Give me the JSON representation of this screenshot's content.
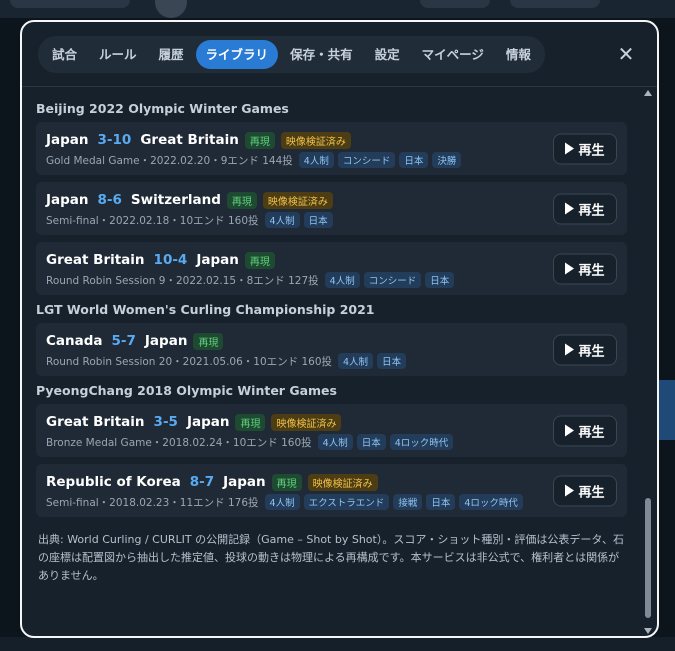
{
  "tabs": [
    {
      "label": "試合",
      "active": false
    },
    {
      "label": "ルール",
      "active": false
    },
    {
      "label": "履歴",
      "active": false
    },
    {
      "label": "ライブラリ",
      "active": true
    },
    {
      "label": "保存・共有",
      "active": false
    },
    {
      "label": "設定",
      "active": false
    },
    {
      "label": "マイページ",
      "active": false
    },
    {
      "label": "情報",
      "active": false
    }
  ],
  "close_symbol": "✕",
  "play_label": "再生",
  "badges": {
    "replay": "再現",
    "verified": "映像検証済み"
  },
  "sections": [
    {
      "title": "Beijing 2022 Olympic Winter Games",
      "games": [
        {
          "team1": "Japan",
          "score": "3-10",
          "team2": "Great Britain",
          "verified": true,
          "meta": "Gold Medal Game・2022.02.20・9エンド 144投",
          "tags": [
            "4人制",
            "コンシード",
            "日本",
            "決勝"
          ]
        },
        {
          "team1": "Japan",
          "score": "8-6",
          "team2": "Switzerland",
          "verified": true,
          "meta": "Semi-final・2022.02.18・10エンド 160投",
          "tags": [
            "4人制",
            "日本"
          ]
        },
        {
          "team1": "Great Britain",
          "score": "10-4",
          "team2": "Japan",
          "verified": false,
          "meta": "Round Robin Session 9・2022.02.15・8エンド 127投",
          "tags": [
            "4人制",
            "コンシード",
            "日本"
          ]
        }
      ]
    },
    {
      "title": "LGT World Women's Curling Championship 2021",
      "games": [
        {
          "team1": "Canada",
          "score": "5-7",
          "team2": "Japan",
          "verified": false,
          "meta": "Round Robin Session 20・2021.05.06・10エンド 160投",
          "tags": [
            "4人制",
            "日本"
          ]
        }
      ]
    },
    {
      "title": "PyeongChang 2018 Olympic Winter Games",
      "games": [
        {
          "team1": "Great Britain",
          "score": "3-5",
          "team2": "Japan",
          "verified": true,
          "meta": "Bronze Medal Game・2018.02.24・10エンド 160投",
          "tags": [
            "4人制",
            "日本",
            "4ロック時代"
          ]
        },
        {
          "team1": "Republic of Korea",
          "score": "8-7",
          "team2": "Japan",
          "verified": true,
          "meta": "Semi-final・2018.02.23・11エンド 176投",
          "tags": [
            "4人制",
            "エクストラエンド",
            "接戦",
            "日本",
            "4ロック時代"
          ]
        }
      ]
    }
  ],
  "footnote": "出典: World Curling / CURLIT の公開記録（Game – Shot by Shot）。スコア・ショット種別・評価は公表データ、石の座標は配置図から抽出した推定値、投球の動きは物理による再構成です。本サービスは非公式で、権利者とは関係がありません。",
  "colors": {
    "accent": "#2a7bd3",
    "score": "#5aaaf2",
    "replay_badge": "#5fd37e",
    "verified_badge": "#f1c14a"
  }
}
